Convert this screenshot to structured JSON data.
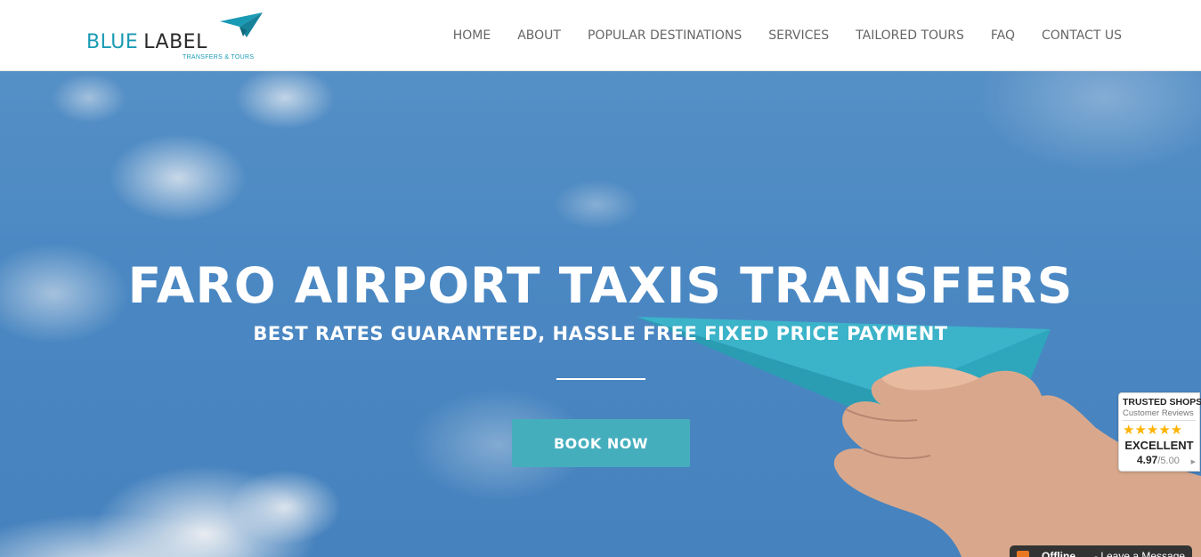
{
  "brand": {
    "name_part1": "BLUE",
    "name_part2": "LABEL",
    "tagline": "TRANSFERS & TOURS",
    "accent_color": "#1a9bb5"
  },
  "nav": {
    "items": [
      {
        "label": "HOME"
      },
      {
        "label": "ABOUT"
      },
      {
        "label": "POPULAR DESTINATIONS"
      },
      {
        "label": "SERVICES"
      },
      {
        "label": "TAILORED TOURS"
      },
      {
        "label": "FAQ"
      },
      {
        "label": "CONTACT US"
      }
    ]
  },
  "hero": {
    "title": "FARO AIRPORT TAXIS TRANSFERS",
    "subtitle": "BEST RATES GUARANTEED, HASSLE FREE FIXED PRICE PAYMENT",
    "cta_label": "BOOK NOW",
    "cta_color": "#45aebd"
  },
  "trusted_shops": {
    "title": "TRUSTED SHOPS",
    "subtitle": "Customer Reviews",
    "stars": "★★★★★",
    "rating_stars": 5,
    "grade": "EXCELLENT",
    "score": "4.97",
    "max": "/5.00"
  },
  "chat": {
    "status": "Offline",
    "message": "- Leave a Message"
  }
}
